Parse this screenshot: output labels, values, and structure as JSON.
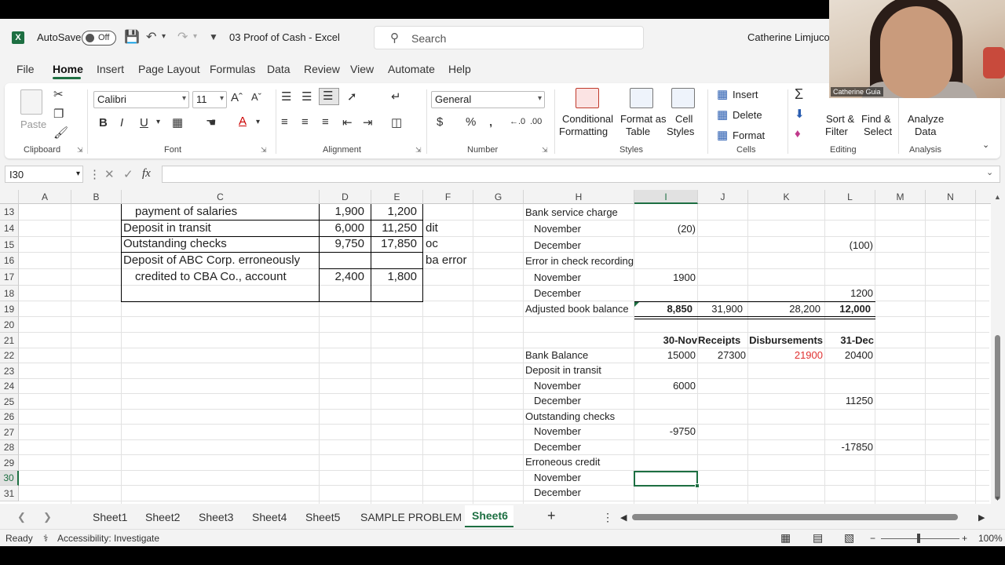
{
  "titlebar": {
    "autosave": "AutoSave",
    "toggle": "Off",
    "doc_title": "03 Proof of Cash  -  Excel",
    "search_placeholder": "Search",
    "user": "Catherine Limjuco"
  },
  "menu": [
    "File",
    "Home",
    "Insert",
    "Page Layout",
    "Formulas",
    "Data",
    "Review",
    "View",
    "Automate",
    "Help"
  ],
  "ribbon": {
    "paste": "Paste",
    "clipboard": "Clipboard",
    "font_name": "Calibri",
    "font_size": "11",
    "bold": "B",
    "italic": "I",
    "underline": "U",
    "font": "Font",
    "alignment": "Alignment",
    "number_format": "General",
    "number": "Number",
    "cond_format_1": "Conditional",
    "cond_format_2": "Formatting",
    "format_table_1": "Format as",
    "format_table_2": "Table",
    "cell_styles_1": "Cell",
    "cell_styles_2": "Styles",
    "styles": "Styles",
    "insert": "Insert",
    "delete": "Delete",
    "format": "Format",
    "cells": "Cells",
    "sort_1": "Sort &",
    "sort_2": "Filter",
    "find_1": "Find &",
    "find_2": "Select",
    "editing": "Editing",
    "analyze_1": "Analyze",
    "analyze_2": "Data",
    "analysis": "Analysis"
  },
  "formula_bar": {
    "name_box": "I30",
    "fx": "fx",
    "value": ""
  },
  "columns": [
    "A",
    "B",
    "C",
    "D",
    "E",
    "F",
    "G",
    "H",
    "I",
    "J",
    "K",
    "L",
    "M",
    "N"
  ],
  "rows": [
    "13",
    "14",
    "15",
    "16",
    "17",
    "18",
    "19",
    "20",
    "21",
    "22",
    "23",
    "24",
    "25",
    "26",
    "27",
    "28",
    "29",
    "30",
    "31"
  ],
  "cells": {
    "c13": "payment of salaries",
    "d13": "1,900",
    "e13": "1,200",
    "c14": "Deposit in transit",
    "d14": "6,000",
    "e14": "11,250",
    "f14": "dit",
    "c15": "Outstanding checks",
    "d15": "9,750",
    "e15": "17,850",
    "f15": "oc",
    "c16": "Deposit of ABC Corp. erroneously",
    "f16": "ba error",
    "c17": "credited to CBA Co., account",
    "d17": "2,400",
    "e17": "1,800",
    "h13": "Bank service charge",
    "h14": "November",
    "i14": "(20)",
    "h15": "December",
    "l15": "(100)",
    "h16": "Error in check recording",
    "h17": "November",
    "i17": "1900",
    "h18": "December",
    "l18": "1200",
    "h19": "Adjusted book balance",
    "i19": "8,850",
    "j19": "31,900",
    "k19": "28,200",
    "l19": "12,000",
    "i21": "30-Nov",
    "j21": "Receipts",
    "k21": "Disbursements",
    "l21": "31-Dec",
    "h22": "Bank Balance",
    "i22": "15000",
    "j22": "27300",
    "k22": "21900",
    "l22": "20400",
    "h23": "Deposit in transit",
    "h24": "November",
    "i24": "6000",
    "h25": "December",
    "l25": "11250",
    "h26": "Outstanding checks",
    "h27": "November",
    "i27": "-9750",
    "h28": "December",
    "l28": "-17850",
    "h29": "Erroneous credit",
    "h30": "November",
    "h31": "December"
  },
  "sheets": [
    "Sheet1",
    "Sheet2",
    "Sheet3",
    "Sheet4",
    "Sheet5",
    "SAMPLE PROBLEM",
    "Sheet6"
  ],
  "status": {
    "ready": "Ready",
    "accessibility": "Accessibility: Investigate",
    "zoom": "100%"
  },
  "webcam": {
    "name": "Catherine Guia"
  },
  "colors": {
    "accent": "#1d6f42",
    "negative": "#e03030"
  }
}
